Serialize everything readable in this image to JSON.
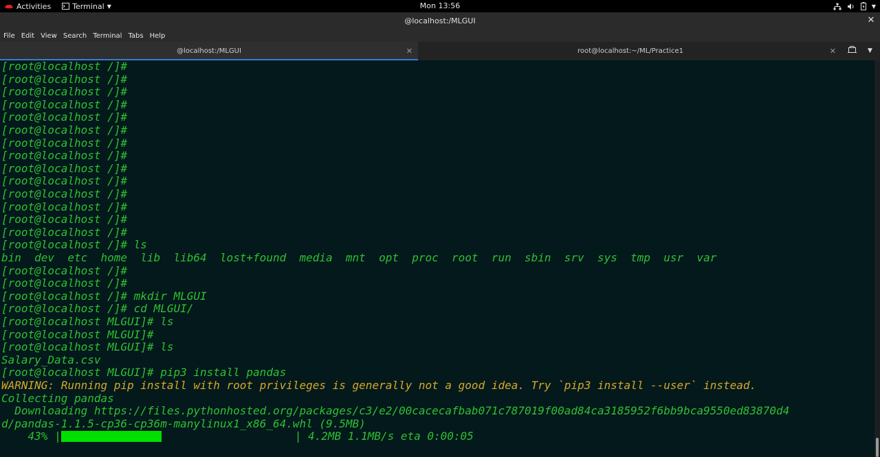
{
  "topbar": {
    "activities": "Activities",
    "app_name": "Terminal",
    "clock": "Mon 13:56"
  },
  "window": {
    "title": "@localhost:/MLGUI"
  },
  "menu": [
    "File",
    "Edit",
    "View",
    "Search",
    "Terminal",
    "Tabs",
    "Help"
  ],
  "tabs": [
    {
      "label": "@localhost:/MLGUI",
      "active": true
    },
    {
      "label": "root@localhost:~/ML/Practice1",
      "active": false
    }
  ],
  "terminal": {
    "prompt_root": "[root@localhost /]#",
    "lines": [
      "[root@localhost /]#",
      "[root@localhost /]#",
      "[root@localhost /]#",
      "[root@localhost /]#",
      "[root@localhost /]#",
      "[root@localhost /]#",
      "[root@localhost /]#",
      "[root@localhost /]#",
      "[root@localhost /]#",
      "[root@localhost /]#",
      "[root@localhost /]#",
      "[root@localhost /]#",
      "[root@localhost /]#",
      "[root@localhost /]#",
      "[root@localhost /]# ls",
      "bin  dev  etc  home  lib  lib64  lost+found  media  mnt  opt  proc  root  run  sbin  srv  sys  tmp  usr  var",
      "[root@localhost /]#",
      "[root@localhost /]#",
      "[root@localhost /]# mkdir MLGUI",
      "[root@localhost /]# cd MLGUI/",
      "[root@localhost MLGUI]# ls",
      "[root@localhost MLGUI]#",
      "[root@localhost MLGUI]# ls",
      "Salary_Data.csv",
      "[root@localhost MLGUI]# pip3 install pandas"
    ],
    "warning": "WARNING: Running pip install with root privileges is generally not a good idea. Try `pip3 install --user` instead.",
    "collecting": "Collecting pandas",
    "downloading_1": "  Downloading https://files.pythonhosted.org/packages/c3/e2/00cacecafbab071c787019f00ad84ca3185952f6bb9bca9550ed83870d4",
    "downloading_2": "d/pandas-1.1.5-cp36-cp36m-manylinux1_x86_64.whl (9.5MB)",
    "progress_percent": "    43%",
    "progress_fraction": 0.43,
    "progress_tail": "| 4.2MB 1.1MB/s eta 0:00:05"
  },
  "colors": {
    "background": "#03191c",
    "text_green": "#30c030",
    "warning": "#d7a827",
    "progress": "#00e000",
    "tab_indicator": "#3a7bd5"
  }
}
